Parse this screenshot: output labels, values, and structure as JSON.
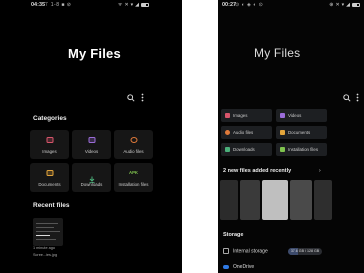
{
  "left": {
    "status": {
      "time": "04:35",
      "notifications": "⊤ 1-8 ■ ⊘",
      "right": "ᯤ ✕ ▾ ◢"
    },
    "title": "My Files",
    "categories_header": "Categories",
    "categories": [
      {
        "label": "Images",
        "icon": "images-icon",
        "color": "#d8556b"
      },
      {
        "label": "Videos",
        "icon": "videos-icon",
        "color": "#9b6cd9"
      },
      {
        "label": "Audio files",
        "icon": "audio-icon",
        "color": "#e07a3a"
      },
      {
        "label": "Documents",
        "icon": "documents-icon",
        "color": "#e3a53b"
      },
      {
        "label": "Downloads",
        "icon": "downloads-icon",
        "color": "#4bb07a"
      },
      {
        "label": "Installation files",
        "icon": "apk-icon",
        "color": "#7fc24e",
        "glyph": "APK"
      }
    ],
    "recent_header": "Recent files",
    "recent": {
      "time": "1 minute ago",
      "name": "Scree...ies.jpg"
    }
  },
  "right": {
    "status": {
      "time": "00:27",
      "notifications": "⊙ ◐ ◈ ◐ ⊙",
      "right": "⊕ ✕ ▾ ◢"
    },
    "title": "My Files",
    "categories": [
      {
        "label": "Images",
        "icon": "images-icon",
        "color": "#d8556b"
      },
      {
        "label": "Videos",
        "icon": "videos-icon",
        "color": "#9b6cd9"
      },
      {
        "label": "Audio files",
        "icon": "audio-icon",
        "color": "#e07a3a"
      },
      {
        "label": "Documents",
        "icon": "documents-icon",
        "color": "#e3a53b"
      },
      {
        "label": "Downloads",
        "icon": "downloads-icon",
        "color": "#4bb07a"
      },
      {
        "label": "Installation files",
        "icon": "apk-icon",
        "color": "#7fc24e"
      }
    ],
    "recent_header": "2 new files added recently",
    "storage_header": "Storage",
    "storage": [
      {
        "label": "Internal storage",
        "value": "37.6 GB / 128 GB",
        "fraction": 0.3
      },
      {
        "label": "OneDrive"
      }
    ]
  },
  "colors": {
    "background": "#000000",
    "tile": "#161616",
    "accent": "#3c4a6b"
  }
}
